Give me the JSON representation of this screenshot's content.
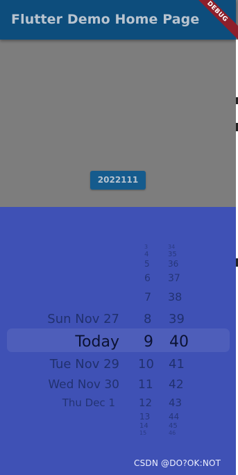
{
  "app_bar": {
    "title": "Flutter Demo Home Page",
    "debug_label": "DEBUG"
  },
  "page": {
    "date_button_label": "2022111"
  },
  "picker": {
    "dates": [
      "Sun Nov 27",
      "Today",
      "Tue Nov 29",
      "Wed Nov 30",
      "Thu Dec 1"
    ],
    "hours": [
      "3",
      "4",
      "5",
      "6",
      "7",
      "8",
      "9",
      "10",
      "11",
      "12",
      "13",
      "14",
      "15"
    ],
    "minutes": [
      "34",
      "35",
      "36",
      "37",
      "38",
      "39",
      "40",
      "41",
      "42",
      "43",
      "44",
      "45",
      "46"
    ],
    "selected": {
      "date": "Today",
      "hour": "9",
      "minute": "40"
    }
  },
  "watermark": "CSDN @DO?OK:NOT",
  "colors": {
    "app_bar": "#0d4d7c",
    "page_background": "#7d7d7d",
    "picker_background": "#3f51b5",
    "button": "#155b8d"
  }
}
